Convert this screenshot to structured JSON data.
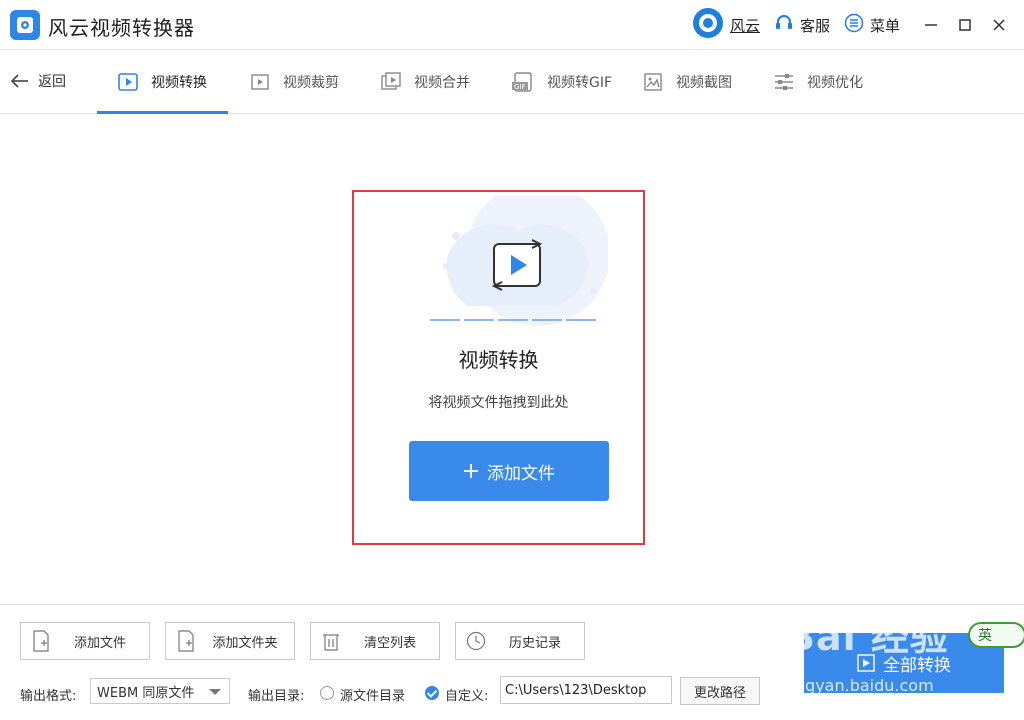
{
  "app": {
    "title": "风云视频转换器"
  },
  "titlebar": {
    "user": "风云",
    "support": "客服",
    "menu": "菜单"
  },
  "nav": {
    "back": "返回",
    "tabs": [
      {
        "label": "视频转换",
        "icon": "video-convert-icon"
      },
      {
        "label": "视频裁剪",
        "icon": "video-crop-icon"
      },
      {
        "label": "视频合并",
        "icon": "video-merge-icon"
      },
      {
        "label": "视频转GIF",
        "icon": "gif-icon"
      },
      {
        "label": "视频截图",
        "icon": "screenshot-icon"
      },
      {
        "label": "视频优化",
        "icon": "optimize-icon"
      }
    ]
  },
  "dropzone": {
    "title": "视频转换",
    "hint": "将视频文件拖拽到此处",
    "button": "添加文件"
  },
  "bottom": {
    "buttons": [
      {
        "label": "添加文件"
      },
      {
        "label": "添加文件夹"
      },
      {
        "label": "清空列表"
      },
      {
        "label": "历史记录"
      }
    ],
    "format_label": "输出格式:",
    "format_value": "WEBM 同原文件",
    "dir_label": "输出目录:",
    "option_source": "源文件目录",
    "option_custom": "自定义:",
    "path_value": "C:\\Users\\123\\Desktop",
    "change_path": "更改路径",
    "convert_all": "全部转换"
  },
  "overlay": {
    "watermark": "Bai 经验",
    "watermark_url": "jingyan.baidu.com",
    "ime": "英"
  },
  "colors": {
    "accent": "#3a8aeb",
    "highlight_border": "#e0393e"
  }
}
